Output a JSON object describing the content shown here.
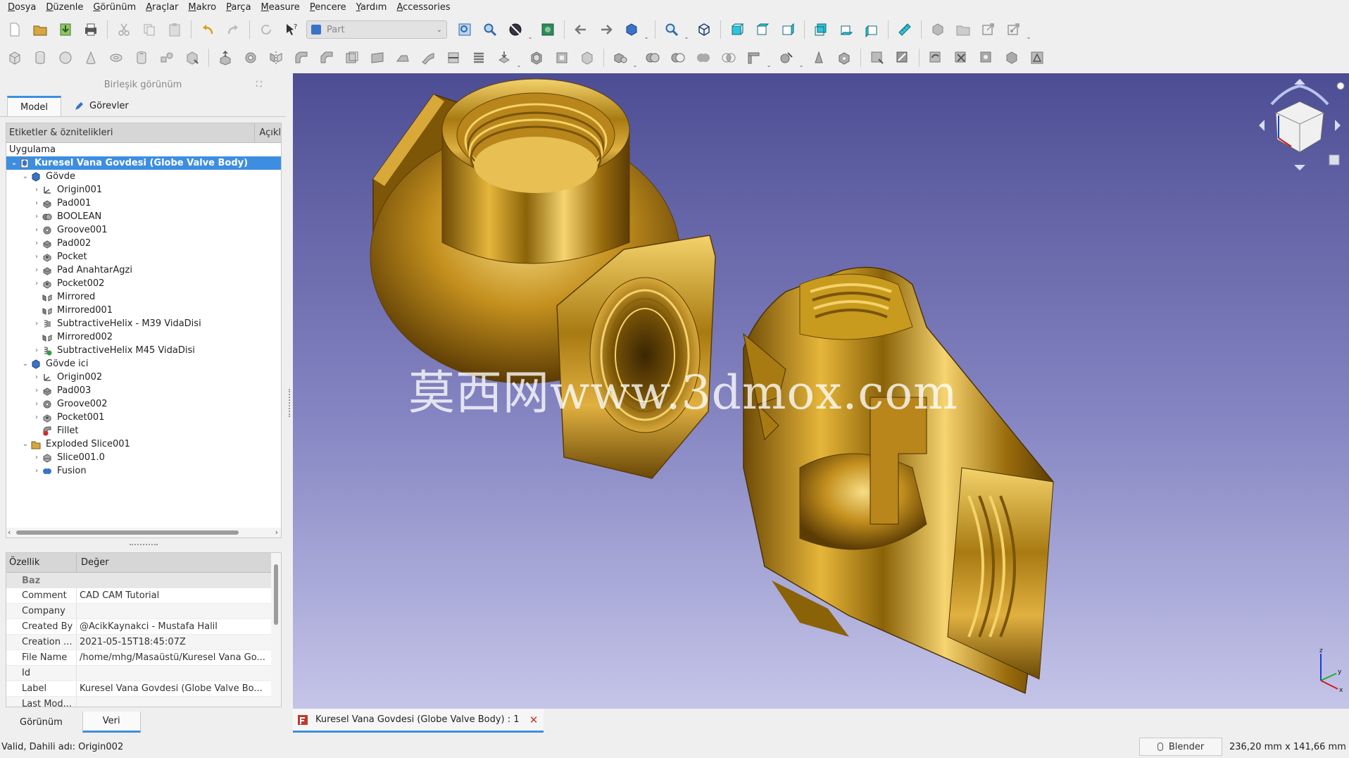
{
  "menu": [
    "Dosya",
    "Düzenle",
    "Görünüm",
    "Araçlar",
    "Makro",
    "Parça",
    "Measure",
    "Pencere",
    "Yardım",
    "Accessories"
  ],
  "workbench_selector": {
    "value": "Part"
  },
  "combo_view": {
    "title": "Birleşik görünüm"
  },
  "tabs": {
    "model": "Model",
    "tasks": "Görevler"
  },
  "tree": {
    "header_labels": "Etiketler & öznitelikleri",
    "header_desc": "Açıkl",
    "root_label": "Uygulama",
    "items": [
      {
        "label": "Kuresel Vana Govdesi (Globe Valve Body)",
        "level": 0,
        "expander": "v",
        "icon": "document-icon",
        "selected": true
      },
      {
        "label": "Gövde",
        "level": 1,
        "expander": "v",
        "icon": "body-icon"
      },
      {
        "label": "Origin001",
        "level": 2,
        "expander": ">",
        "icon": "origin-icon"
      },
      {
        "label": "Pad001",
        "level": 2,
        "expander": ">",
        "icon": "pad-icon"
      },
      {
        "label": "BOOLEAN",
        "level": 2,
        "expander": ">",
        "icon": "boolean-icon"
      },
      {
        "label": "Groove001",
        "level": 2,
        "expander": ">",
        "icon": "groove-icon"
      },
      {
        "label": "Pad002",
        "level": 2,
        "expander": ">",
        "icon": "pad-icon"
      },
      {
        "label": "Pocket",
        "level": 2,
        "expander": ">",
        "icon": "pocket-icon"
      },
      {
        "label": "Pad AnahtarAgzi",
        "level": 2,
        "expander": ">",
        "icon": "pad-icon"
      },
      {
        "label": "Pocket002",
        "level": 2,
        "expander": ">",
        "icon": "pocket-icon"
      },
      {
        "label": "Mirrored",
        "level": 2,
        "expander": "",
        "icon": "mirror-icon"
      },
      {
        "label": "Mirrored001",
        "level": 2,
        "expander": "",
        "icon": "mirror-icon"
      },
      {
        "label": "SubtractiveHelix - M39 VidaDisi",
        "level": 2,
        "expander": ">",
        "icon": "helix-icon"
      },
      {
        "label": "Mirrored002",
        "level": 2,
        "expander": "",
        "icon": "mirror-icon"
      },
      {
        "label": "SubtractiveHelix M45 VidaDisi",
        "level": 2,
        "expander": ">",
        "icon": "helix-tip-icon"
      },
      {
        "label": "Gövde ici",
        "level": 1,
        "expander": "v",
        "icon": "body-icon"
      },
      {
        "label": "Origin002",
        "level": 2,
        "expander": ">",
        "icon": "origin-icon"
      },
      {
        "label": "Pad003",
        "level": 2,
        "expander": ">",
        "icon": "pad-icon"
      },
      {
        "label": "Groove002",
        "level": 2,
        "expander": ">",
        "icon": "groove-icon"
      },
      {
        "label": "Pocket001",
        "level": 2,
        "expander": ">",
        "icon": "pocket-icon"
      },
      {
        "label": "Fillet",
        "level": 2,
        "expander": "",
        "icon": "fillet-icon"
      },
      {
        "label": "Exploded Slice001",
        "level": 1,
        "expander": "v",
        "icon": "folder-icon"
      },
      {
        "label": "Slice001.0",
        "level": 2,
        "expander": ">",
        "icon": "slice-icon"
      },
      {
        "label": "Fusion",
        "level": 2,
        "expander": ">",
        "icon": "fusion-icon"
      }
    ]
  },
  "properties": {
    "col_property": "Özellik",
    "col_value": "Değer",
    "group": "Baz",
    "rows": [
      {
        "key": "Comment",
        "value": "CAD CAM Tutorial"
      },
      {
        "key": "Company",
        "value": ""
      },
      {
        "key": "Created By",
        "value": "@AcikKaynakci - Mustafa Halil"
      },
      {
        "key": "Creation ...",
        "value": "2021-05-15T18:45:07Z"
      },
      {
        "key": "File Name",
        "value": "/home/mhg/Masaüstü/Kuresel Vana Go..."
      },
      {
        "key": "Id",
        "value": ""
      },
      {
        "key": "Label",
        "value": "Kuresel Vana Govdesi (Globe Valve Bo..."
      },
      {
        "key": "Last Mod...",
        "value": ""
      }
    ]
  },
  "bottom_tabs": {
    "view": "Görünüm",
    "data": "Veri"
  },
  "watermark": "莫西网www.3dmox.com",
  "document_tab": {
    "label": "Kuresel Vana Govdesi (Globe Valve Body) : 1"
  },
  "status": {
    "message": "Valid, Dahili adı: Origin002",
    "navigation": "Blender",
    "dimensions": "236,20 mm x 141,66 mm"
  },
  "colors": {
    "accent": "#3d8ee0",
    "part_gold": "#c89a1e",
    "view_top": "#4d4d94",
    "view_bottom": "#c5c5e9"
  }
}
